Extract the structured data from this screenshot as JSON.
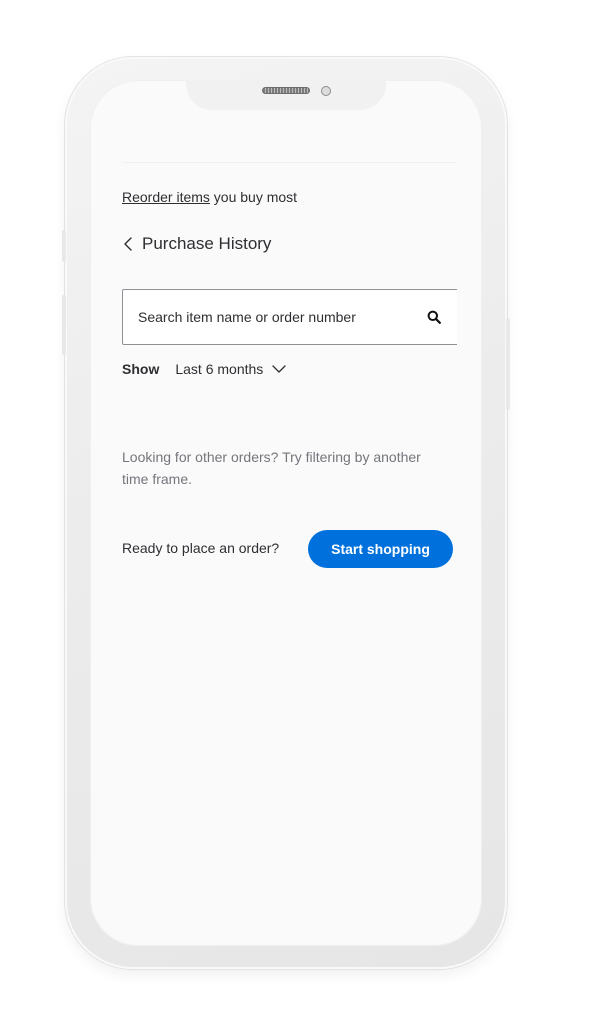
{
  "header": {
    "reorder_link": "Reorder items",
    "reorder_rest": " you buy most",
    "title": "Purchase History"
  },
  "search": {
    "placeholder": "Search item name or order number"
  },
  "filter": {
    "label": "Show",
    "selected": "Last 6 months"
  },
  "help": {
    "line1": "Looking for other orders? Try filtering by another",
    "line2": "time frame."
  },
  "cta": {
    "prompt": "Ready to place an order?",
    "button_label": "Start shopping"
  },
  "colors": {
    "accent": "#0071dc",
    "text": "#2e2f32",
    "muted_text": "#74767c"
  },
  "icons": [
    "chevron-left-icon",
    "search-icon",
    "chevron-down-icon"
  ]
}
